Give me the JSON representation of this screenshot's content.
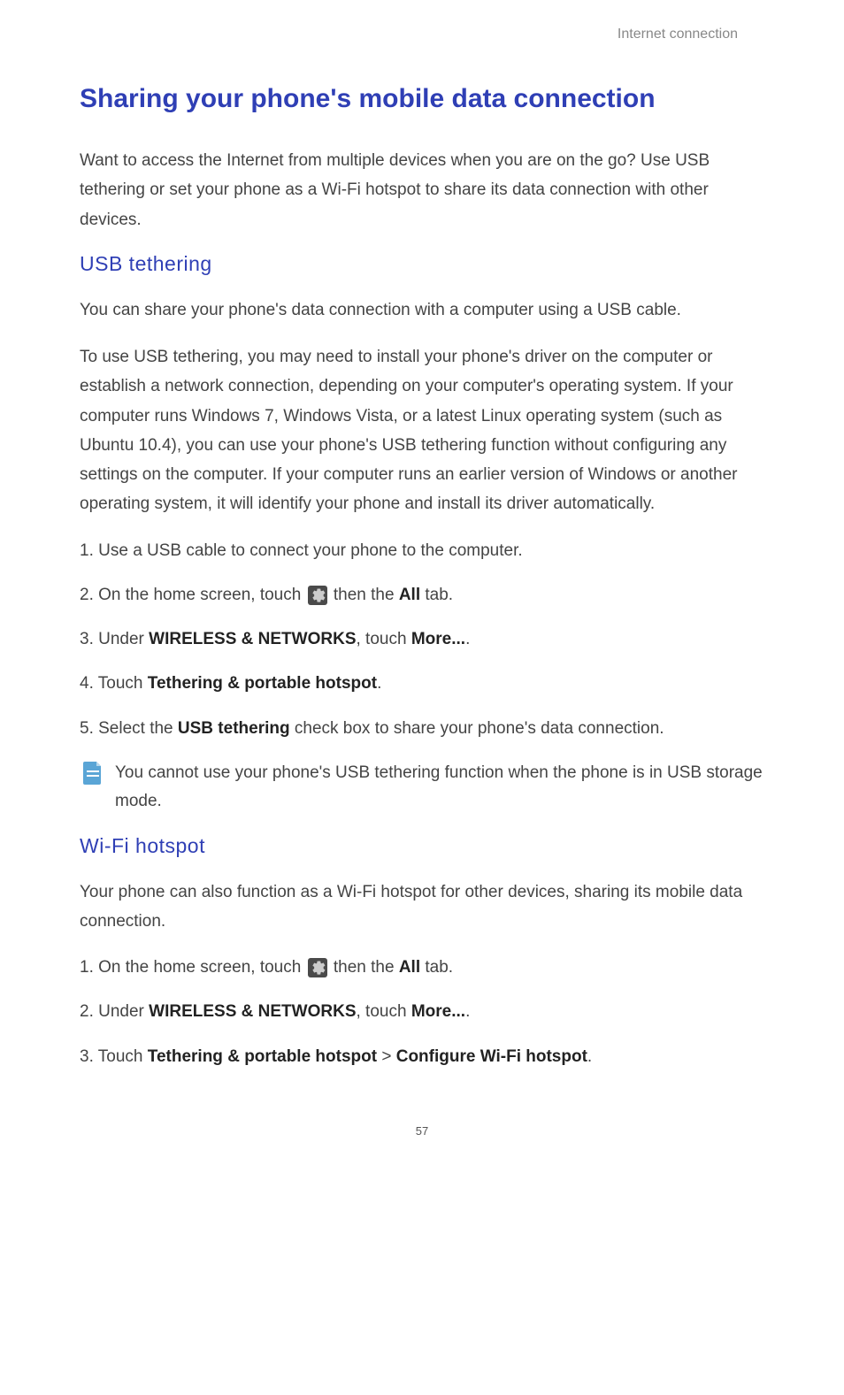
{
  "header": "Internet connection",
  "title": "Sharing your phone's mobile data connection",
  "intro": "Want to access the Internet from multiple devices when you are on the go? Use USB tethering or set your phone as a Wi-Fi hotspot to share its data connection with other devices.",
  "usb": {
    "heading": "USB  tethering",
    "p1": "You can share your phone's data connection with a computer using a USB cable.",
    "p2": "To use USB tethering, you may need to install your phone's driver on the computer or establish a network connection, depending on your computer's operating system. If your computer runs Windows 7, Windows Vista, or a latest Linux operating system (such as Ubuntu 10.4), you can use your phone's USB tethering function without configuring any settings on the computer. If your computer runs an earlier version of Windows or another operating system, it will identify your phone and install its driver automatically.",
    "steps": {
      "s1": "Use a USB cable to connect your phone to the computer.",
      "s2a": "On the home screen, touch ",
      "s2b": " then the ",
      "s2_all": "All",
      "s2c": " tab.",
      "s3a": "Under ",
      "s3_wn": "WIRELESS & NETWORKS",
      "s3b": ", touch ",
      "s3_more": "More...",
      "s3c": ".",
      "s4a": "Touch ",
      "s4_t": "Tethering & portable hotspot",
      "s4b": ".",
      "s5a": "Select the ",
      "s5_usb": "USB tethering",
      "s5b": " check box to share your phone's data connection."
    },
    "note": "You cannot use your phone's USB tethering function when the phone is in USB storage mode."
  },
  "wifi": {
    "heading": "Wi-Fi  hotspot",
    "p1": "Your phone can also function as a Wi-Fi hotspot for other devices, sharing its mobile data connection.",
    "steps": {
      "s1a": "On the home screen, touch ",
      "s1b": " then the ",
      "s1_all": "All",
      "s1c": " tab.",
      "s2a": "Under ",
      "s2_wn": "WIRELESS & NETWORKS",
      "s2b": ", touch ",
      "s2_more": "More...",
      "s2c": ".",
      "s3a": "Touch ",
      "s3_t": "Tethering & portable hotspot",
      "s3b": " > ",
      "s3_c": "Configure Wi-Fi hotspot",
      "s3c": "."
    }
  },
  "pageNumber": "57"
}
